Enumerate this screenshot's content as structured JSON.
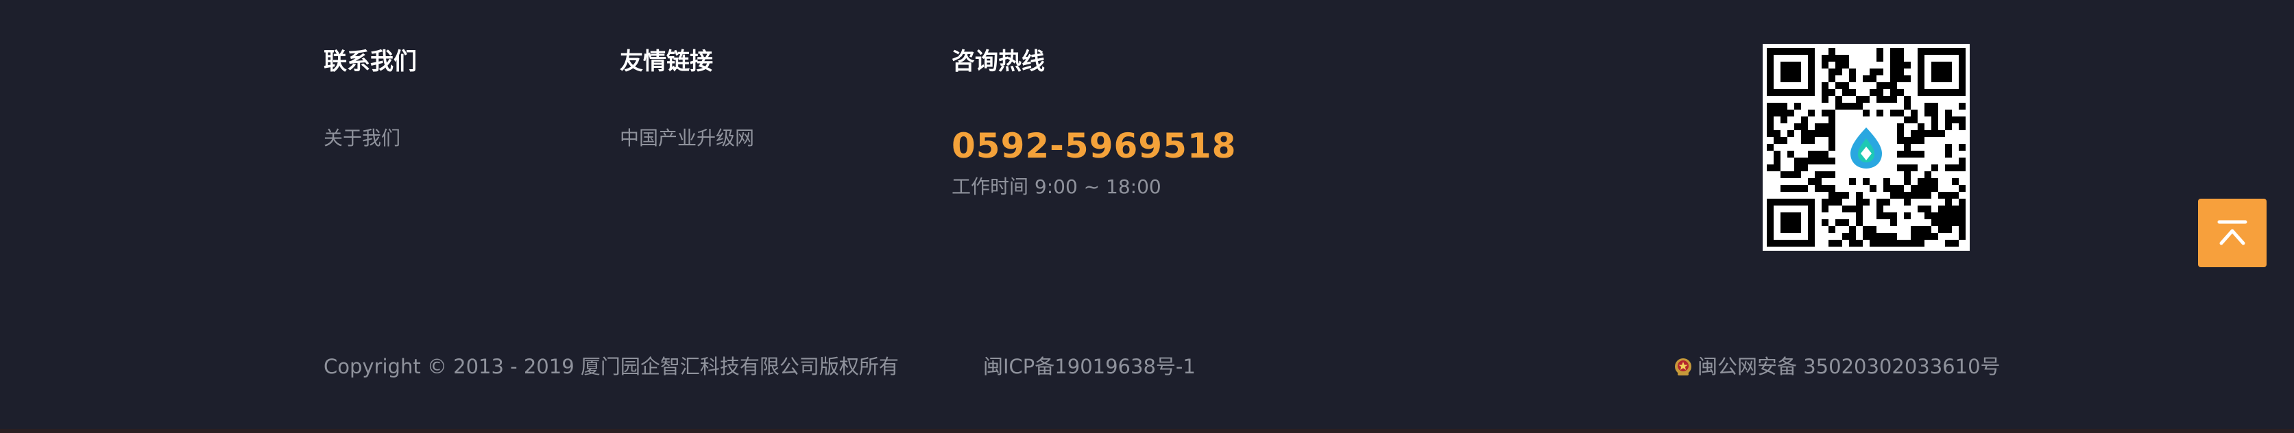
{
  "columns": {
    "contact": {
      "title": "联系我们",
      "link": "关于我们"
    },
    "friends": {
      "title": "友情链接",
      "link": "中国产业升级网"
    },
    "hotline": {
      "title": "咨询热线",
      "number": "0592-5969518",
      "hours": "工作时间 9:00 ~ 18:00"
    }
  },
  "qr_code": {
    "icon": "qr-code-icon"
  },
  "back_to_top": {
    "icon": "arrow-up-to-top-icon"
  },
  "bottom": {
    "copyright": "Copyright © 2013 - 2019 厦门园企智汇科技有限公司版权所有",
    "icp": "闽ICP备19019638号-1",
    "police": "闽公网安备 35020302033610号"
  },
  "colors": {
    "background": "#1d1f2c",
    "accent": "#f4a23a",
    "muted_text": "#8f929c",
    "back_to_top": "#f7a03c"
  }
}
